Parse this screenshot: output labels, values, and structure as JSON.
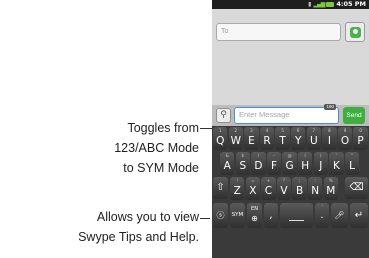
{
  "callouts": {
    "sym_toggle": [
      "Toggles from",
      "123/ABC Mode",
      "to SYM Mode"
    ],
    "swype_help": [
      "Allows you to view",
      "Swype Tips and Help."
    ]
  },
  "status": {
    "time": "4:05 PM",
    "icons": [
      "sim-icon",
      "signal-bars-icon",
      "battery-icon"
    ]
  },
  "compose": {
    "to_placeholder": "To",
    "message_placeholder": "Enter Message",
    "char_count": "160",
    "send_label": "Send",
    "contact_icon": "add-contact-icon",
    "attach_icon": "paperclip-icon"
  },
  "keyboard": {
    "row1": [
      {
        "label": "Q",
        "sub": "1"
      },
      {
        "label": "W",
        "sub": "2"
      },
      {
        "label": "E",
        "sub": "3"
      },
      {
        "label": "R",
        "sub": "4"
      },
      {
        "label": "T",
        "sub": "5"
      },
      {
        "label": "Y",
        "sub": "6"
      },
      {
        "label": "U",
        "sub": "7"
      },
      {
        "label": "I",
        "sub": "8"
      },
      {
        "label": "O",
        "sub": "9"
      },
      {
        "label": "P",
        "sub": "0"
      }
    ],
    "row2": [
      {
        "label": "A",
        "sub": "&"
      },
      {
        "label": "S",
        "sub": "$"
      },
      {
        "label": "D",
        "sub": "/"
      },
      {
        "label": "F",
        "sub": "-"
      },
      {
        "label": "G",
        "sub": "@"
      },
      {
        "label": "H",
        "sub": "("
      },
      {
        "label": "J",
        "sub": ")"
      },
      {
        "label": "K",
        "sub": "'"
      },
      {
        "label": "L",
        "sub": "\""
      }
    ],
    "row3": [
      {
        "label": "Z",
        "sub": "!"
      },
      {
        "label": "X",
        "sub": "="
      },
      {
        "label": "C",
        "sub": "+"
      },
      {
        "label": "V",
        "sub": "?"
      },
      {
        "label": "B",
        "sub": ";"
      },
      {
        "label": "N",
        "sub": ":"
      },
      {
        "label": "M",
        "sub": "%"
      }
    ],
    "shift_icon": "shift-arrow-icon",
    "delete_icon": "backspace-icon",
    "swype_icon": "swype-help-icon",
    "sym_label": "SYM",
    "lang_label": "EN",
    "globe_icon": "globe-icon",
    "comma": ",",
    "period": ".",
    "period_sub": "'",
    "mic_icon": "microphone-icon",
    "enter_icon": "enter-arrow-icon"
  }
}
